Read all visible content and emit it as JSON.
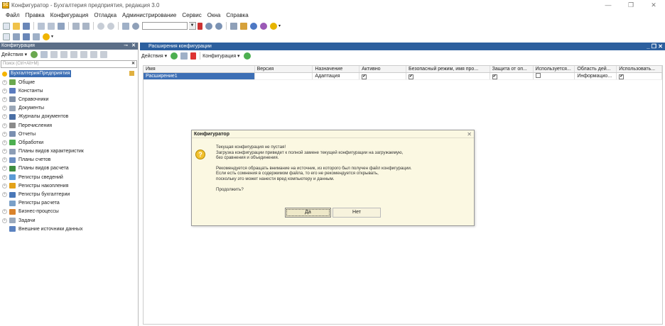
{
  "window": {
    "title": "Конфигуратор - Бухгалтерия предприятия, редакция 3.0",
    "min": "—",
    "restore": "❐",
    "close": "✕"
  },
  "menu": [
    "Файл",
    "Правка",
    "Конфигурация",
    "Отладка",
    "Администрирование",
    "Сервис",
    "Окна",
    "Справка"
  ],
  "left_panel": {
    "title": "Конфигурация",
    "actions_label": "Действия ▾",
    "search_placeholder": "Поиск (Ctrl+Alt+M)",
    "root": "БухгалтерияПредприятия",
    "items": [
      {
        "label": "Общие",
        "icon": "common-icon",
        "expand": "+",
        "color": "#6aa84f"
      },
      {
        "label": "Константы",
        "icon": "constants-icon",
        "expand": "+",
        "color": "#5a7bbf"
      },
      {
        "label": "Справочники",
        "icon": "catalogs-icon",
        "expand": "+",
        "color": "#7f8fa6"
      },
      {
        "label": "Документы",
        "icon": "documents-icon",
        "expand": "+",
        "color": "#9aa7b8"
      },
      {
        "label": "Журналы документов",
        "icon": "journals-icon",
        "expand": "+",
        "color": "#4a6fa5"
      },
      {
        "label": "Перечисления",
        "icon": "enums-icon",
        "expand": "+",
        "color": "#8a8a8a"
      },
      {
        "label": "Отчеты",
        "icon": "reports-icon",
        "expand": "+",
        "color": "#7a8fb0"
      },
      {
        "label": "Обработки",
        "icon": "dataprocessors-icon",
        "expand": "+",
        "color": "#4caf50"
      },
      {
        "label": "Планы видов характеристик",
        "icon": "chart-of-characteristics-icon",
        "expand": "+",
        "color": "#8c9db5"
      },
      {
        "label": "Планы счетов",
        "icon": "chart-of-accounts-icon",
        "expand": "+",
        "color": "#6b8fc2"
      },
      {
        "label": "Планы видов расчета",
        "icon": "chart-of-calculations-icon",
        "expand": "+",
        "color": "#3e8e41"
      },
      {
        "label": "Регистры сведений",
        "icon": "info-registers-icon",
        "expand": "+",
        "color": "#5b9bd5"
      },
      {
        "label": "Регистры накопления",
        "icon": "accumulation-registers-icon",
        "expand": "+",
        "color": "#e3a21a"
      },
      {
        "label": "Регистры бухгалтерии",
        "icon": "accounting-registers-icon",
        "expand": "+",
        "color": "#4a78b8"
      },
      {
        "label": "Регистры расчета",
        "icon": "calculation-registers-icon",
        "expand": "",
        "color": "#7aa0c8"
      },
      {
        "label": "Бизнес-процессы",
        "icon": "business-processes-icon",
        "expand": "+",
        "color": "#d9822b"
      },
      {
        "label": "Задачи",
        "icon": "tasks-icon",
        "expand": "+",
        "color": "#9aa9bd"
      },
      {
        "label": "Внешние источники данных",
        "icon": "external-sources-icon",
        "expand": "",
        "color": "#5b82c0"
      }
    ]
  },
  "right_panel": {
    "title": "Расширения конфигурации",
    "actions_label": "Действия ▾",
    "config_label": "Конфигурация ▾",
    "columns": [
      "Имя",
      "Версия",
      "Назначение",
      "Активно",
      "Безопасный режим, имя про...",
      "Защита от оп...",
      "Используется...",
      "Область дей...",
      "Использовать..."
    ],
    "rows": [
      {
        "name": "Расширение1",
        "version": "",
        "purpose": "Адаптация",
        "active": "✔",
        "safe_mode": "✔",
        "protection": "✔",
        "used": "",
        "scope": "Информацио...",
        "use": "✔"
      }
    ]
  },
  "dialog": {
    "title": "Конфигуратор",
    "close": "✕",
    "icon_glyph": "?",
    "lines1": [
      "Текущая конфигурация не пустая!",
      "Загрузка конфигурации приведет к полной замене текущей конфигурации на загружаемую,",
      "без сравнения и объединения."
    ],
    "lines2": [
      "Рекомендуется обращать внимание на источник, из которого был получен файл конфигурации.",
      "Если есть сомнения в содержимом файла, то его не рекомендуется открывать,",
      "поскольку это может нанести вред компьютеру и данным."
    ],
    "question": "Продолжить?",
    "yes": "Да",
    "no": "Нет"
  }
}
